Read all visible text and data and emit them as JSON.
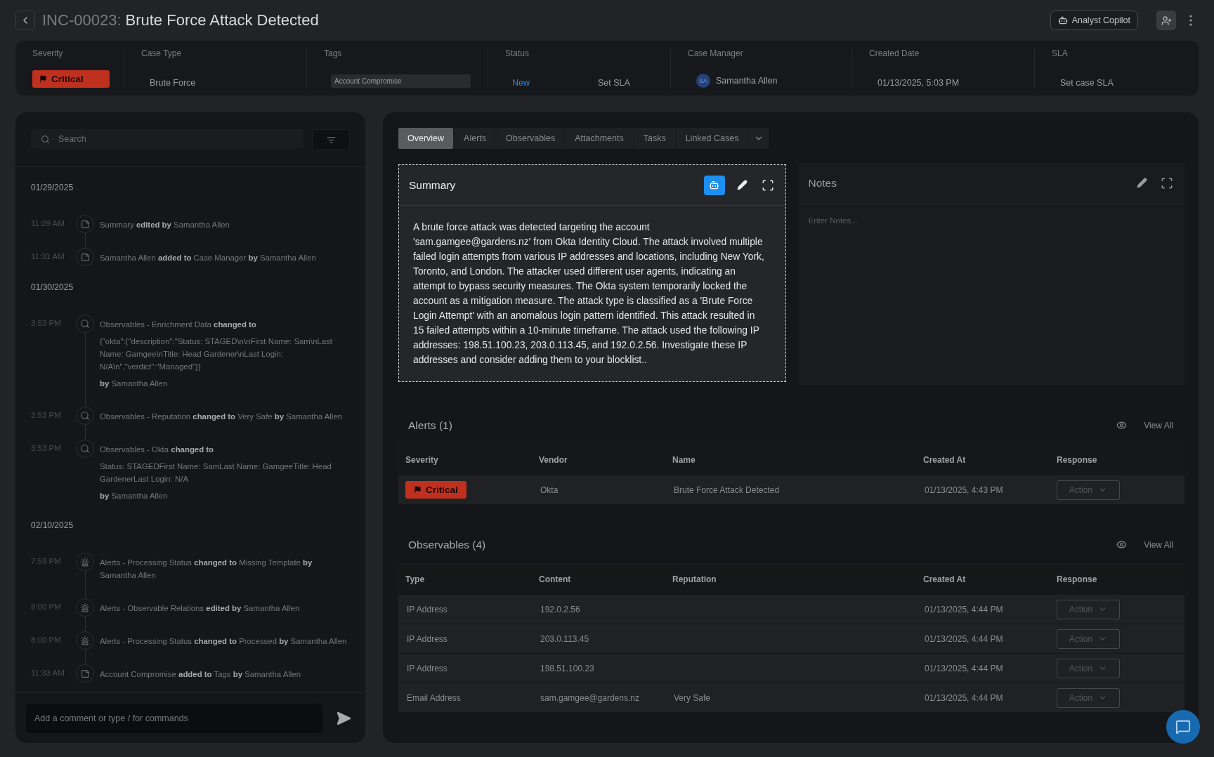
{
  "header": {
    "case_id": "INC-00023:",
    "title": "Brute Force Attack Detected",
    "copilot_button": "Analyst Copilot"
  },
  "info_bar": [
    {
      "kind": "severity",
      "label": "Severity",
      "value": "Critical"
    },
    {
      "kind": "text",
      "label": "Case Type",
      "value": "Brute Force"
    },
    {
      "kind": "tag",
      "label": "Tags",
      "value": "Account Compromise"
    },
    {
      "kind": "status",
      "label": "Status",
      "value": "New",
      "action": "Set SLA"
    },
    {
      "kind": "person",
      "label": "Case Manager",
      "initials": "SA",
      "value": "Samantha Allen"
    },
    {
      "kind": "text",
      "label": "Created Date",
      "value": "01/13/2025, 5:03 PM"
    },
    {
      "kind": "text",
      "label": "SLA",
      "value": "Set case SLA"
    }
  ],
  "activity": {
    "search": {
      "placeholder": "Search"
    },
    "entries": [
      {
        "kind": "date",
        "text": "01/29/2025"
      },
      {
        "kind": "note",
        "time": "11:29 AM",
        "lines": [
          "Summary **edited by** Samantha Allen"
        ]
      },
      {
        "kind": "note",
        "time": "11:31 AM",
        "lines": [
          "Samantha Allen **added to** Case Manager **by** Samantha Allen"
        ]
      },
      {
        "kind": "date",
        "text": "01/30/2025"
      },
      {
        "kind": "search",
        "time": "3:53 PM",
        "lines": [
          "Observables - Enrichment Data **changed to**",
          "{\"okta\":{\"description\":\"Status: STAGED\\n\\nFirst Name: Sam\\nLast Name: Gamgee\\nTitle: Head Gardener\\nLast Login: N/A\\n\",\"verdict\":\"Managed\"}}",
          "**by** Samantha Allen"
        ]
      },
      {
        "kind": "search",
        "time": "3:53 PM",
        "lines": [
          "Observables - Reputation **changed to** Very Safe **by** Samantha Allen"
        ]
      },
      {
        "kind": "search",
        "time": "3:53 PM",
        "lines": [
          "Observables - Okta **changed to**",
          "Status: STAGEDFirst Name: SamLast Name: GamgeeTitle: Head GardenerLast Login: N/A",
          "**by** Samantha Allen"
        ]
      },
      {
        "kind": "date",
        "text": "02/10/2025"
      },
      {
        "kind": "alarm",
        "time": "7:59 PM",
        "lines": [
          "Alerts - Processing Status **changed to** Missing Template **by** Samantha Allen"
        ]
      },
      {
        "kind": "alarm",
        "time": "8:00 PM",
        "lines": [
          "Alerts - Observable Relations **edited by** Samantha Allen"
        ]
      },
      {
        "kind": "alarm",
        "time": "8:00 PM",
        "lines": [
          "Alerts - Processing Status **changed to** Processed **by** Samantha Allen"
        ]
      },
      {
        "kind": "note",
        "time": "11:33 AM",
        "lines": [
          "Account Compromise **added to** Tags **by** Samantha Allen"
        ]
      }
    ],
    "comment": {
      "placeholder": "Add a comment or type / for commands"
    }
  },
  "tabs": [
    {
      "label": "Overview",
      "selected": true
    },
    {
      "label": "Alerts",
      "selected": false
    },
    {
      "label": "Observables",
      "selected": false
    },
    {
      "label": "Attachments",
      "selected": false
    },
    {
      "label": "Tasks",
      "selected": false
    },
    {
      "label": "Linked Cases",
      "selected": false
    }
  ],
  "summary": {
    "title": "Summary",
    "text": "A brute force attack was detected targeting the account 'sam.gamgee@gardens.nz' from Okta Identity Cloud. The attack involved multiple failed login attempts from various IP addresses and locations, including New York, Toronto, and London. The attacker used different user agents, indicating an attempt to bypass security measures.  The Okta system temporarily locked the account as a mitigation measure. The attack type is classified as a 'Brute Force Login Attempt' with an anomalous login pattern identified. This attack resulted in 15 failed attempts within a 10-minute timeframe.  The attack used the following IP addresses: 198.51.100.23, 203.0.113.45, and 192.0.2.56.  Investigate these IP addresses and consider adding them to your blocklist.."
  },
  "notes": {
    "title": "Notes",
    "placeholder": "Enter Notes..."
  },
  "alerts": {
    "title": "Alerts (1)",
    "view_all": "View All",
    "columns": [
      "Severity",
      "Vendor",
      "Name",
      "Created At",
      "Response"
    ],
    "rows": [
      {
        "severity": "Critical",
        "vendor": "Okta",
        "name": "Brute Force Attack Detected",
        "created_at": "01/13/2025, 4:43 PM",
        "action": "Action"
      }
    ]
  },
  "observables": {
    "title": "Observables (4)",
    "view_all": "View All",
    "columns": [
      "Type",
      "Content",
      "Reputation",
      "Created At",
      "Response"
    ],
    "rows": [
      {
        "type": "IP Address",
        "content": "192.0.2.56",
        "reputation": "",
        "created_at": "01/13/2025, 4:44 PM",
        "action": "Action"
      },
      {
        "type": "IP Address",
        "content": "203.0.113.45",
        "reputation": "",
        "created_at": "01/13/2025, 4:44 PM",
        "action": "Action"
      },
      {
        "type": "IP Address",
        "content": "198.51.100.23",
        "reputation": "",
        "created_at": "01/13/2025, 4:44 PM",
        "action": "Action"
      },
      {
        "type": "Email Address",
        "content": "sam.gamgee@gardens.nz",
        "reputation": "Very Safe",
        "created_at": "01/13/2025, 4:44 PM",
        "action": "Action"
      }
    ]
  }
}
